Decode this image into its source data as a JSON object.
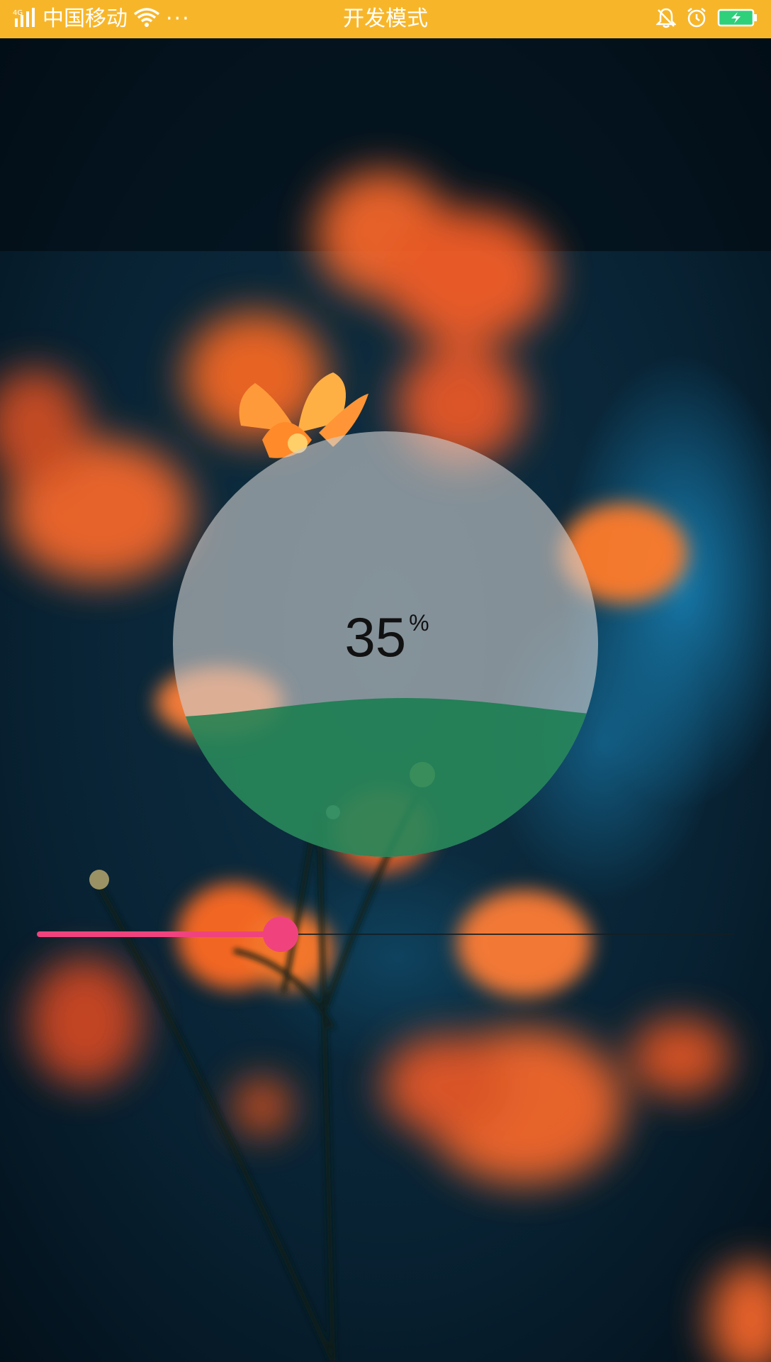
{
  "status_bar": {
    "carrier": "中国移动",
    "title": "开发模式",
    "more_dots": "···",
    "icons": [
      "signal-icon",
      "wifi-icon",
      "bell-icon",
      "alarm-icon",
      "battery-charging-icon"
    ]
  },
  "wave_progress": {
    "value": "35",
    "unit": "%",
    "fraction": 0.35,
    "wave_color": "#0a7a45",
    "circle_color": "#c8c8c8"
  },
  "slider": {
    "value_fraction": 0.35,
    "accent_color": "#f0437d"
  },
  "colors": {
    "status_bar": "#f7b62a",
    "accent": "#f0437d"
  }
}
